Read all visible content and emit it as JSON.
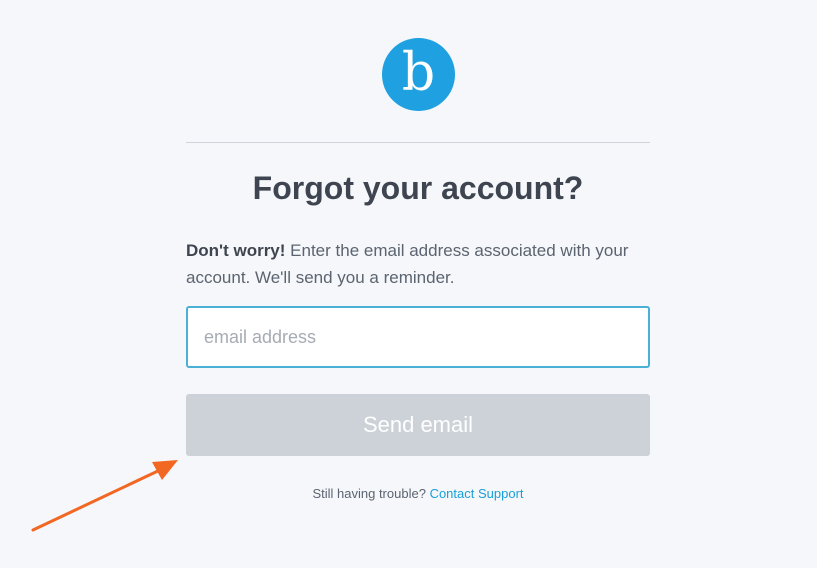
{
  "logo": {
    "letter": "b",
    "brand_color": "#1fa0e0"
  },
  "title": "Forgot your account?",
  "description": {
    "bold": "Don't worry!",
    "text": " Enter the email address associated with your account. We'll send you a reminder."
  },
  "email_input": {
    "placeholder": "email address",
    "value": ""
  },
  "send_button": {
    "label": "Send email",
    "disabled": true
  },
  "help": {
    "text": "Still having trouble?",
    "link": "Contact Support"
  },
  "annotation": {
    "type": "arrow-icon",
    "color": "#f26722"
  }
}
